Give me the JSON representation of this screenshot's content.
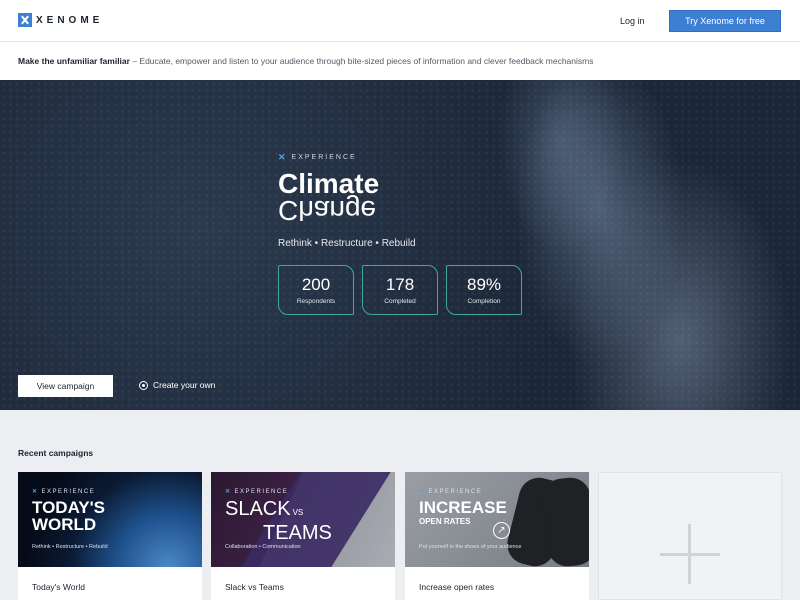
{
  "header": {
    "brand": "XENOME",
    "login_label": "Log in",
    "cta_label": "Try Xenome for free"
  },
  "tagline": {
    "bold": "Make the unfamiliar familiar",
    "rest": " – Educate, empower and listen to your audience through bite-sized pieces of information and clever feedback mechanisms"
  },
  "hero": {
    "eyebrow": "EXPERIENCE",
    "title_line1": "Climate",
    "title_line2": "Change",
    "subtitle": "Rethink • Restructure • Rebuild",
    "stats": [
      {
        "value": "200",
        "label": "Respondents"
      },
      {
        "value": "178",
        "label": "Completed"
      },
      {
        "value": "89%",
        "label": "Completion"
      }
    ],
    "view_label": "View campaign",
    "create_label": "Create your own"
  },
  "recent": {
    "title": "Recent campaigns",
    "cards": [
      {
        "eyebrow": "EXPERIENCE",
        "headline1": "TODAY'S",
        "headline2": "WORLD",
        "sub": "Rethink • Restructure • Rebuild",
        "label": "Today's World"
      },
      {
        "eyebrow": "EXPERIENCE",
        "headline1": "SLACK",
        "vs": "VS",
        "headline2": "TEAMS",
        "sub": "Collaboration • Communication",
        "label": "Slack vs Teams"
      },
      {
        "eyebrow": "EXPERIENCE",
        "headline1": "INCREASE",
        "headline2": "OPEN RATES",
        "sub": "Put yourself in the shoes of your audience",
        "label": "Increase open rates"
      }
    ]
  },
  "colors": {
    "accent": "#3d7fd3",
    "stat_border": "#3fa79a"
  }
}
